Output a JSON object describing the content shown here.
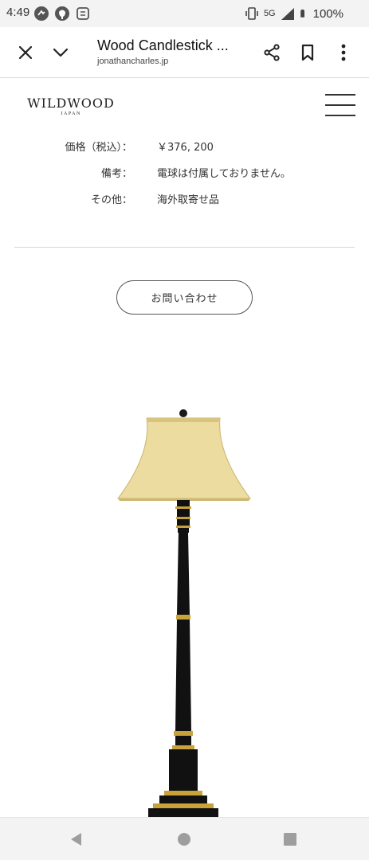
{
  "status_bar": {
    "time": "4:49",
    "network": "5G",
    "battery": "100%",
    "icons_left": [
      "notification-icon",
      "github-icon",
      "app-icon"
    ],
    "icons_right": [
      "vibrate-icon",
      "signal-icon",
      "battery-icon"
    ]
  },
  "toolbar": {
    "title": "Wood Candlestick ...",
    "url": "jonathancharles.jp",
    "icons": [
      "close-icon",
      "chevron-down-icon",
      "share-icon",
      "bookmark-icon",
      "more-vert-icon"
    ]
  },
  "site": {
    "logo_main": "WILDWOOD",
    "logo_sub": "JAPAN",
    "menu_icon": "hamburger-menu-icon"
  },
  "specs": [
    {
      "label": "価格（税込）：",
      "value": "￥376, 200"
    },
    {
      "label": "備考：",
      "value": "電球は付属しておりません。"
    },
    {
      "label": "その他：",
      "value": "海外取寄せ品"
    }
  ],
  "contact": {
    "label": "お問い合わせ"
  },
  "product_image": {
    "description_icon": "floor-lamp-image"
  },
  "colors": {
    "status_bg": "#f3f3f3",
    "lamp_shade": "#ecdca0",
    "lamp_body": "#111111",
    "lamp_gold": "#c9a23a"
  },
  "nav": {
    "icons": [
      "back-icon",
      "home-icon",
      "recents-icon"
    ]
  }
}
